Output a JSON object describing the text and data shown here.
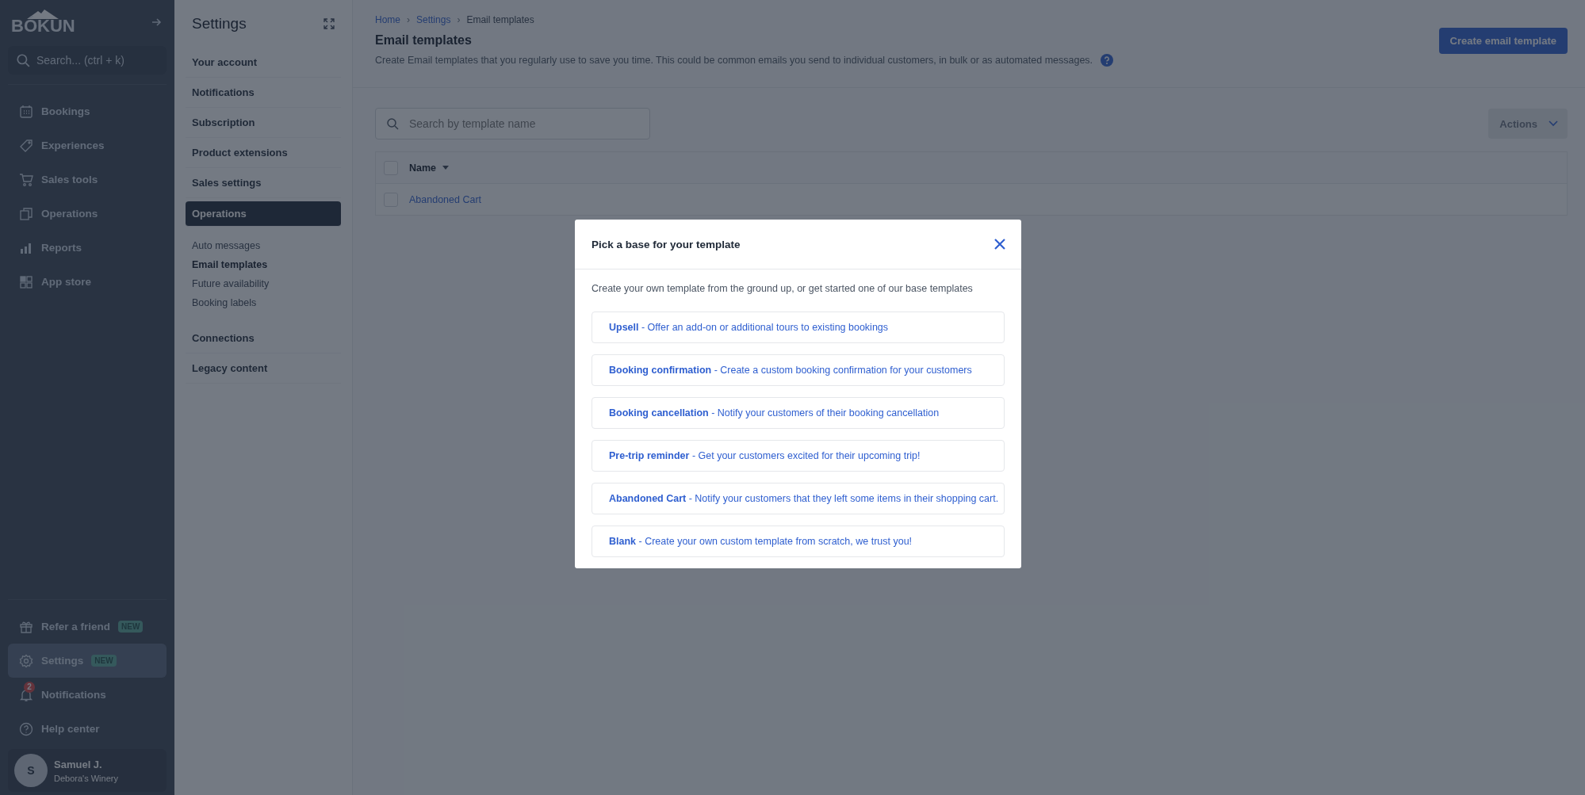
{
  "sidebar": {
    "logo": "BÓKUN",
    "search": {
      "placeholder": "Search... (ctrl + k)"
    },
    "nav": [
      {
        "label": "Bookings"
      },
      {
        "label": "Experiences"
      },
      {
        "label": "Sales tools"
      },
      {
        "label": "Operations"
      },
      {
        "label": "Reports"
      },
      {
        "label": "App store"
      }
    ],
    "bottom": [
      {
        "label": "Refer a friend",
        "badge": "NEW",
        "selected": false
      },
      {
        "label": "Settings",
        "badge": "NEW",
        "selected": true
      },
      {
        "label": "Notifications",
        "count": "2",
        "selected": false
      },
      {
        "label": "Help center",
        "selected": false
      }
    ],
    "user": {
      "initial": "S",
      "name": "Samuel J.",
      "company": "Debora's Winery"
    }
  },
  "settings_panel": {
    "title": "Settings",
    "items": [
      {
        "label": "Your account",
        "selected": false
      },
      {
        "label": "Notifications",
        "selected": false
      },
      {
        "label": "Subscription",
        "selected": false
      },
      {
        "label": "Product extensions",
        "selected": false
      },
      {
        "label": "Sales settings",
        "selected": false
      },
      {
        "label": "Operations",
        "selected": true,
        "children": [
          {
            "label": "Auto messages",
            "selected": false
          },
          {
            "label": "Email templates",
            "selected": true
          },
          {
            "label": "Future availability",
            "selected": false
          },
          {
            "label": "Booking labels",
            "selected": false
          }
        ]
      },
      {
        "label": "Connections",
        "selected": false
      },
      {
        "label": "Legacy content",
        "selected": false
      }
    ]
  },
  "header": {
    "breadcrumb": [
      "Home",
      "Settings",
      "Email templates"
    ],
    "breadcrumb_separator": "›",
    "title": "Email templates",
    "description": "Create Email templates that you regularly use to save you time. This could be common emails you send to individual customers, in bulk or as automated messages.",
    "primary_button": "Create email template"
  },
  "toolbar": {
    "search": {
      "placeholder": "Search by template name"
    },
    "actions_button": "Actions"
  },
  "table": {
    "columns": [
      {
        "label": "Name",
        "checked": false
      }
    ],
    "rows": [
      {
        "name": "Abandoned Cart",
        "checked": false
      }
    ]
  },
  "modal": {
    "title": "Pick a base for your template",
    "intro": "Create your own template from the ground up, or get started one of our base templates",
    "options": [
      "**Upsell** - Offer an add-on or additional tours to existing bookings",
      "**Booking confirmation** - Create a custom booking confirmation for your customers",
      "**Booking cancellation** - Notify your customers of their booking cancellation",
      "**Pre-trip reminder** - Get your customers excited for their upcoming trip!",
      "**Abandoned Cart** - Notify your customers that they left some items in their shopping cart.",
      "**Blank** - Create your own custom template from scratch, we trust you!"
    ]
  }
}
